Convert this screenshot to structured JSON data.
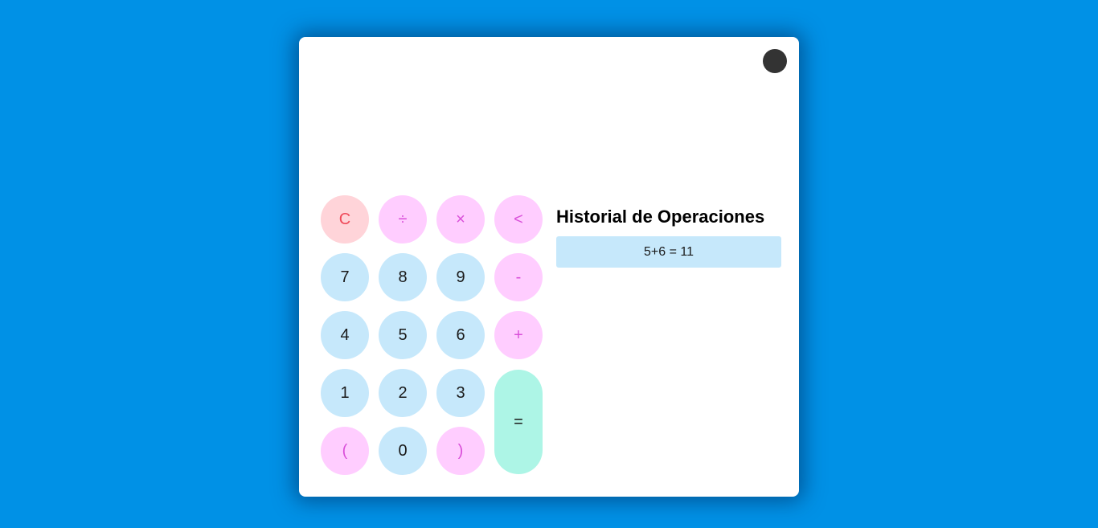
{
  "display": {
    "value": ""
  },
  "keys": {
    "clear": "C",
    "divide": "÷",
    "multiply": "×",
    "backspace": "<",
    "seven": "7",
    "eight": "8",
    "nine": "9",
    "minus": "-",
    "four": "4",
    "five": "5",
    "six": "6",
    "plus": "+",
    "one": "1",
    "two": "2",
    "three": "3",
    "equals": "=",
    "open_paren": "(",
    "zero": "0",
    "close_paren": ")"
  },
  "history": {
    "title": "Historial de Operaciones",
    "items": [
      {
        "text": "5+6 = 11"
      }
    ]
  },
  "colors": {
    "background": "#0091e6",
    "number_key": "#c6e8fb",
    "operator_key": "#ffcdff",
    "clear_key": "#ffd4d9",
    "equals_key": "#adf5e6",
    "toggle": "#333333"
  }
}
